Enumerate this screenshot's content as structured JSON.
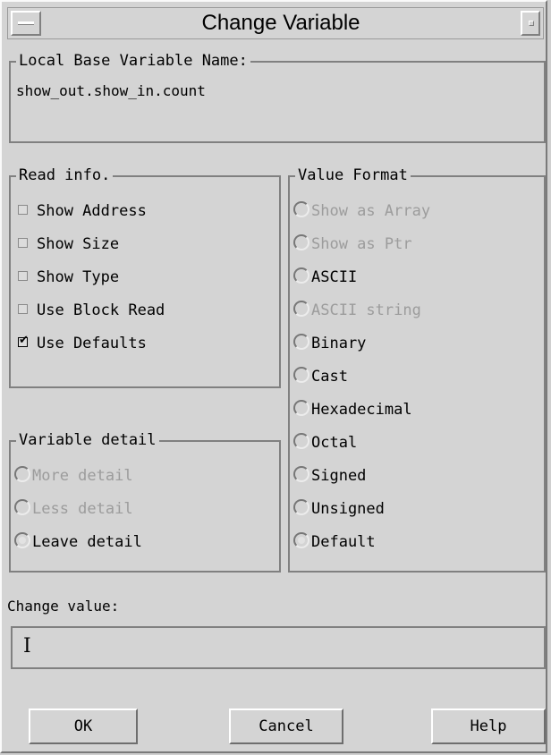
{
  "window": {
    "title": "Change Variable"
  },
  "base_var": {
    "legend": "Local Base Variable Name:",
    "value": "show_out.show_in.count"
  },
  "read_info": {
    "legend": "Read info.",
    "items": [
      {
        "label": "Show Address",
        "checked": false
      },
      {
        "label": "Show Size",
        "checked": false
      },
      {
        "label": "Show Type",
        "checked": false
      },
      {
        "label": "Use Block Read",
        "checked": false
      },
      {
        "label": "Use Defaults",
        "checked": true
      }
    ]
  },
  "variable_detail": {
    "legend": "Variable detail",
    "items": [
      {
        "label": "More detail",
        "enabled": false,
        "selected": false
      },
      {
        "label": "Less detail",
        "enabled": false,
        "selected": false
      },
      {
        "label": "Leave detail",
        "enabled": true,
        "selected": true
      }
    ]
  },
  "value_format": {
    "legend": "Value Format",
    "items": [
      {
        "label": "Show as Array",
        "enabled": false
      },
      {
        "label": "Show as Ptr",
        "enabled": false
      },
      {
        "label": "ASCII",
        "enabled": true
      },
      {
        "label": "ASCII string",
        "enabled": false
      },
      {
        "label": "Binary",
        "enabled": true
      },
      {
        "label": "Cast",
        "enabled": true
      },
      {
        "label": "Hexadecimal",
        "enabled": true
      },
      {
        "label": "Octal",
        "enabled": true
      },
      {
        "label": "Signed",
        "enabled": true
      },
      {
        "label": "Unsigned",
        "enabled": true
      },
      {
        "label": "Default",
        "enabled": true,
        "selected": true
      }
    ]
  },
  "change_value": {
    "label": "Change value:",
    "value": ""
  },
  "buttons": {
    "ok": "OK",
    "cancel": "Cancel",
    "help": "Help"
  }
}
